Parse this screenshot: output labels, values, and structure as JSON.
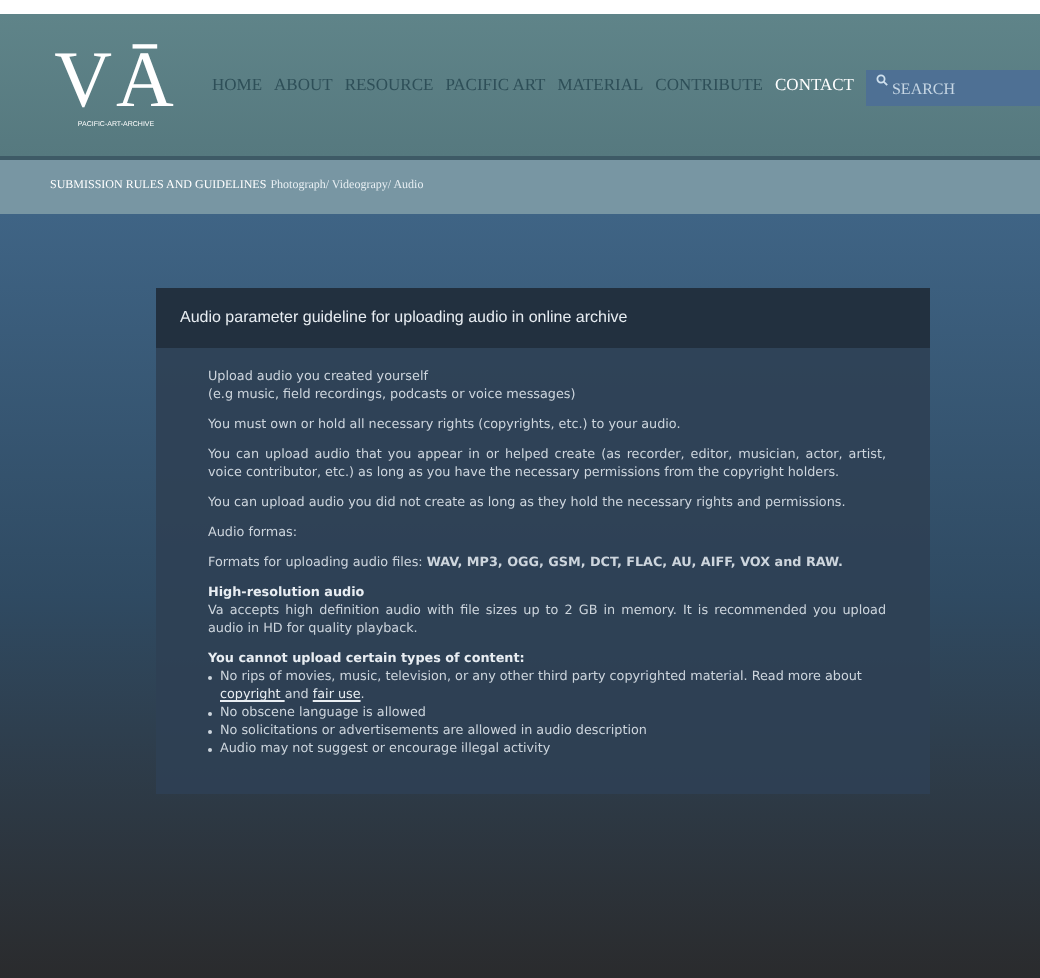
{
  "logo": {
    "mark": "VĀ",
    "tagline": "PACIFIC-ART-ARCHIVE"
  },
  "nav": [
    {
      "label": "HOME",
      "selected": false
    },
    {
      "label": "ABOUT",
      "selected": false
    },
    {
      "label": "RESOURCE",
      "selected": false
    },
    {
      "label": "PACIFIC ART",
      "selected": false
    },
    {
      "label": "MATERIAL",
      "selected": false
    },
    {
      "label": "CONTRIBUTE",
      "selected": false
    },
    {
      "label": "CONTACT",
      "selected": true
    }
  ],
  "search": {
    "placeholder": "SEARCH"
  },
  "breadcrumb": {
    "section": "SUBMISSION RULES AND GUIDELINES",
    "page": "Photograph/ Videograpy/ Audio"
  },
  "panel": {
    "title": "Audio parameter guideline for uploading audio in online archive",
    "blocks": [
      {
        "kind": "lines",
        "lines": [
          "Upload audio you created yourself",
          "(e.g music, field recordings, podcasts or voice messages)"
        ]
      },
      {
        "kind": "para",
        "text": "You must own or hold all necessary rights (copyrights, etc.) to your audio."
      },
      {
        "kind": "para",
        "text": "You can upload audio that you appear in or helped create (as recorder, editor, musician, actor, artist, voice contributor, etc.) as long as you have the necessary permissions from the copyright holders."
      },
      {
        "kind": "para",
        "text": "You can upload audio you did not create as long as they hold the necessary rights and permissions."
      },
      {
        "kind": "para",
        "text": "Audio formas:"
      },
      {
        "kind": "para",
        "text": "Formats for uploading audio files: **WAV, MP3, OGG, GSM, DCT, FLAC, AU, AIFF, VOX and RAW.**"
      },
      {
        "kind": "section",
        "heading": "High-resolution audio",
        "text": "Va accepts high definition audio with file sizes up to 2 GB in memory. It is recommended you upload audio in HD for quality playback."
      },
      {
        "kind": "list",
        "heading": "You cannot upload certain types of content:",
        "items": [
          {
            "parts": [
              {
                "kind": "text",
                "text": "No rips of movies, music, television, or any other third party copyrighted material. Read more about "
              },
              {
                "kind": "link",
                "text": "copyright "
              },
              {
                "kind": "text",
                "text": "and "
              },
              {
                "kind": "link",
                "text": "fair use"
              },
              {
                "kind": "text",
                "text": "."
              }
            ]
          },
          {
            "parts": [
              {
                "kind": "text",
                "text": "No obscene language is allowed"
              }
            ]
          },
          {
            "parts": [
              {
                "kind": "text",
                "text": "No solicitations or advertisements are allowed in audio description"
              }
            ]
          },
          {
            "parts": [
              {
                "kind": "text",
                "text": "Audio may not suggest or encourage illegal activity"
              }
            ]
          }
        ]
      }
    ]
  }
}
